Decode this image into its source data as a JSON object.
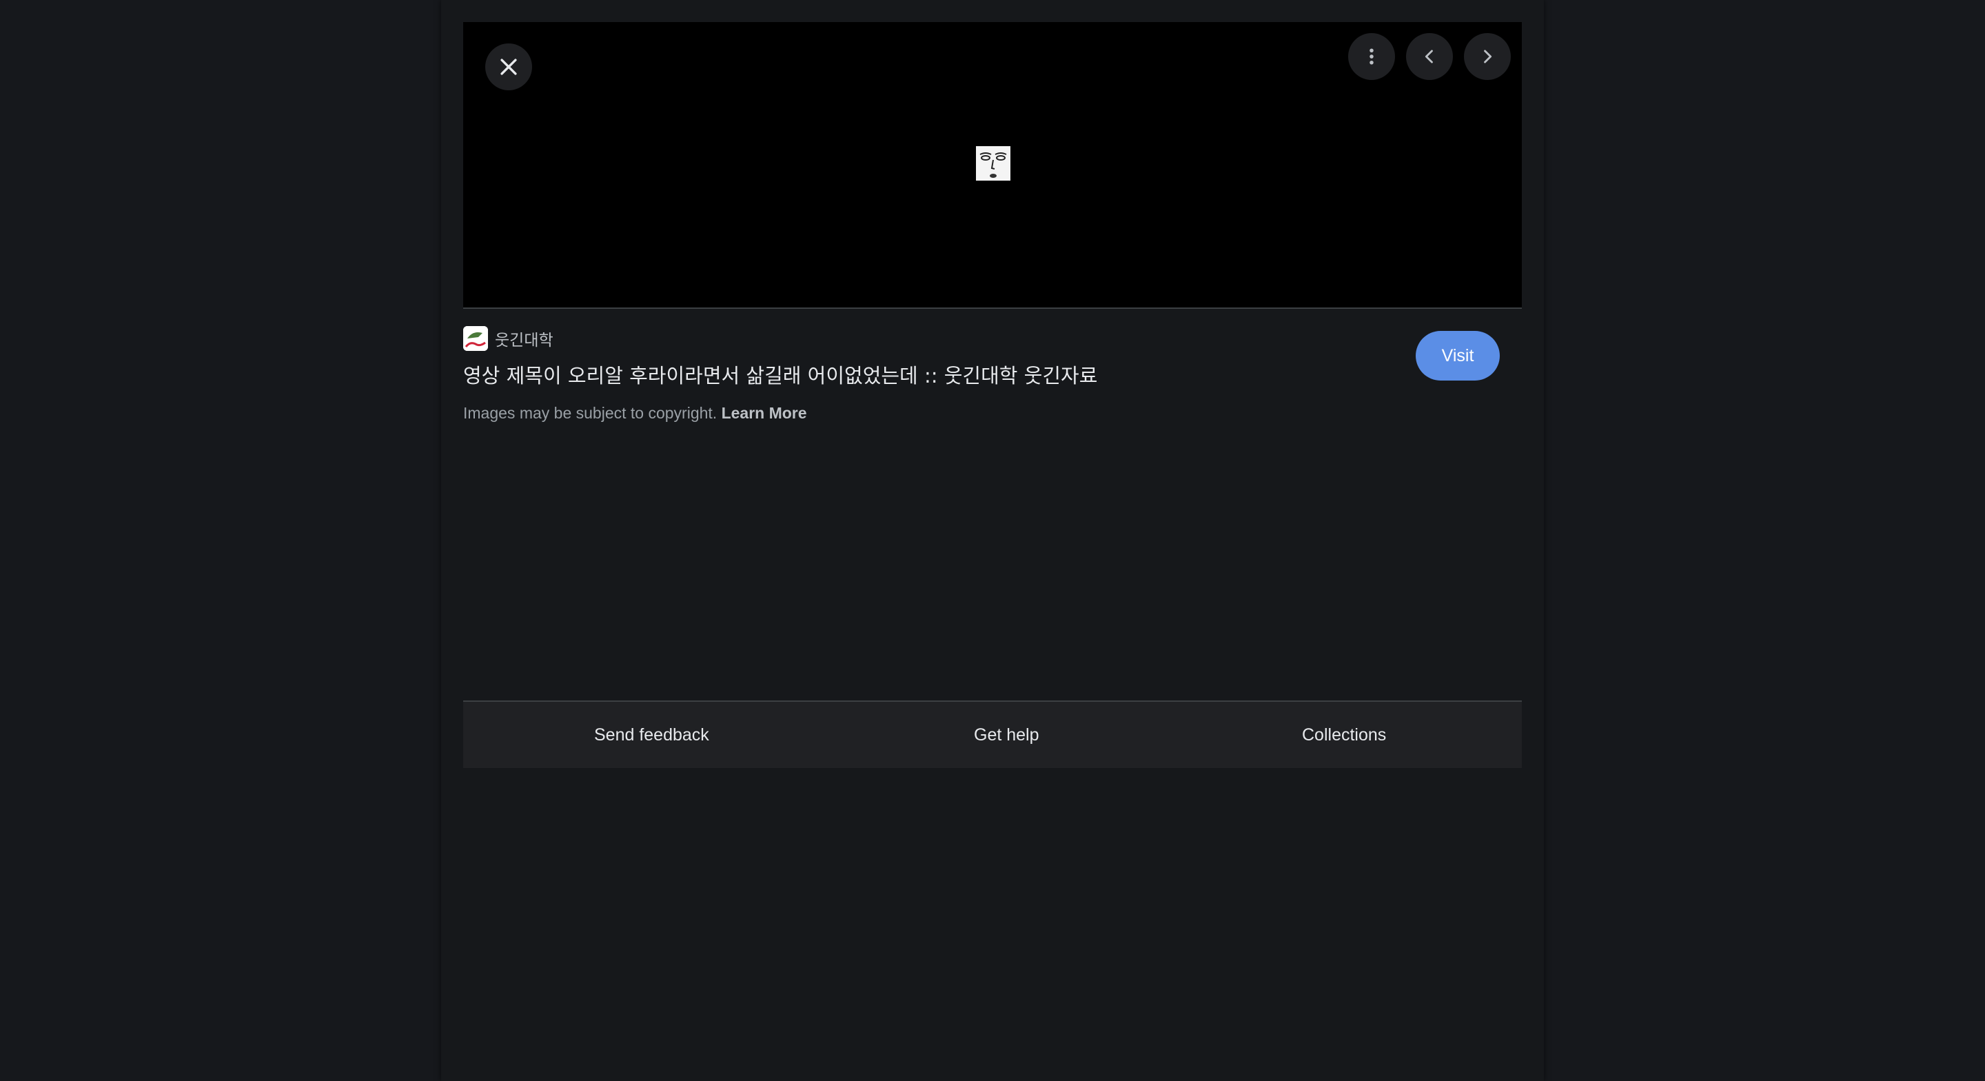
{
  "viewer": {
    "close_icon": "close-icon",
    "more_icon": "more-vert-icon",
    "prev_icon": "chevron-left-icon",
    "next_icon": "chevron-right-icon"
  },
  "result": {
    "site_name": "웃긴대학",
    "title": "영상 제목이 오리알 후라이라면서 삶길래 어이없었는데 :: 웃긴대학 웃긴자료",
    "visit_label": "Visit",
    "copyright_text": "Images may be subject to copyright.",
    "learn_more_label": "Learn More"
  },
  "footer": {
    "send_feedback": "Send feedback",
    "get_help": "Get help",
    "collections": "Collections"
  },
  "colors": {
    "background": "#16181c",
    "viewer_bg": "#000000",
    "visit_button": "#5b8ee6",
    "footer_bg": "#202124"
  }
}
